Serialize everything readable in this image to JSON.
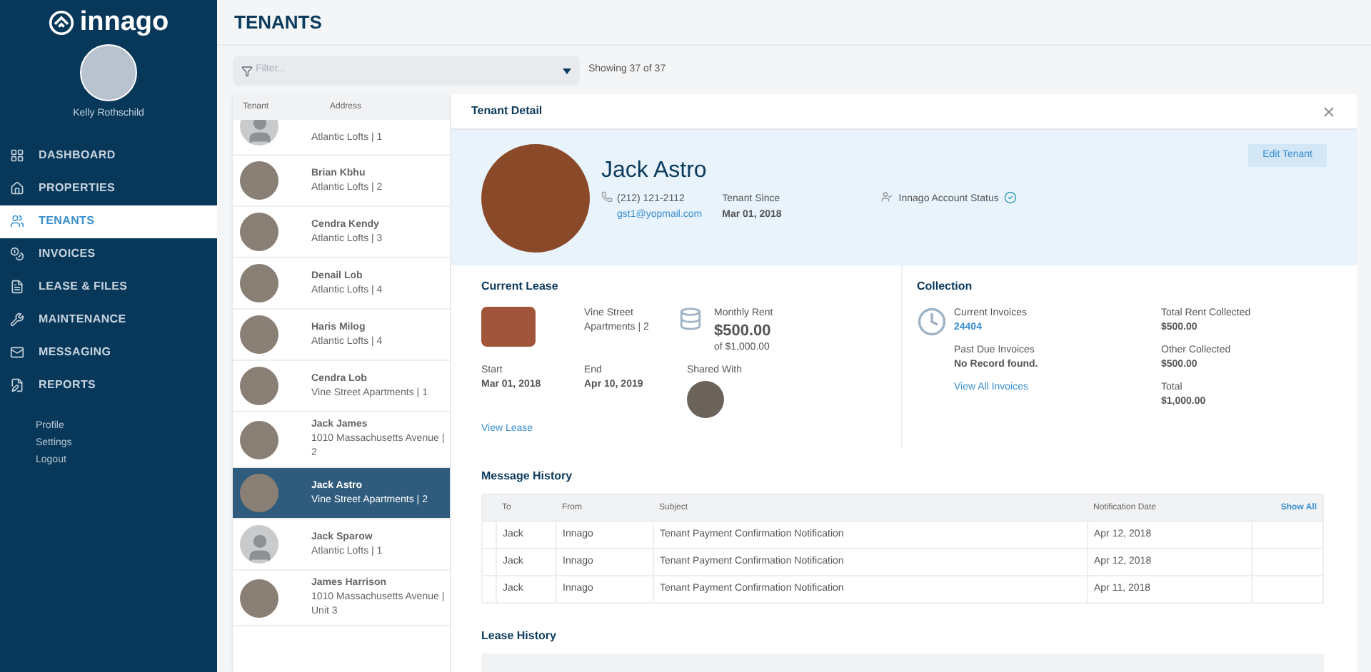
{
  "brand": "innago",
  "user": {
    "name": "Kelly Rothschild"
  },
  "nav": [
    {
      "label": "DASHBOARD",
      "selected": false
    },
    {
      "label": "PROPERTIES",
      "selected": false
    },
    {
      "label": "TENANTS",
      "selected": true
    },
    {
      "label": "INVOICES",
      "selected": false
    },
    {
      "label": "LEASE & FILES",
      "selected": false
    },
    {
      "label": "MAINTENANCE",
      "selected": false
    },
    {
      "label": "MESSAGING",
      "selected": false
    },
    {
      "label": "REPORTS",
      "selected": false
    }
  ],
  "account_links": [
    "Profile",
    "Settings",
    "Logout"
  ],
  "page_title": "TENANTS",
  "filter": {
    "placeholder": "Filter...",
    "count": "Showing 37 of 37"
  },
  "tenant_list": {
    "columns": [
      "Tenant",
      "Address"
    ],
    "rows": [
      {
        "name": "",
        "address": "Atlantic Lofts | 1",
        "photo": false,
        "selected": false
      },
      {
        "name": "Brian Kbhu",
        "address": "Atlantic Lofts | 2",
        "photo": true,
        "selected": false
      },
      {
        "name": "Cendra Kendy",
        "address": "Atlantic Lofts | 3",
        "photo": true,
        "selected": false
      },
      {
        "name": "Denail Lob",
        "address": "Atlantic Lofts | 4",
        "photo": true,
        "selected": false
      },
      {
        "name": "Haris Milog",
        "address": "Atlantic Lofts | 4",
        "photo": true,
        "selected": false
      },
      {
        "name": "Cendra Lob",
        "address": "Vine Street Apartments | 1",
        "photo": true,
        "selected": false
      },
      {
        "name": "Jack  James",
        "address": "1010 Massachusetts Avenue | 2",
        "photo": true,
        "selected": false
      },
      {
        "name": "Jack Astro",
        "address": "Vine Street Apartments | 2",
        "photo": true,
        "selected": true
      },
      {
        "name": "Jack Sparow",
        "address": "Atlantic Lofts | 1",
        "photo": false,
        "selected": false
      },
      {
        "name": "James Harrison",
        "address": "1010 Massachusetts Avenue | Unit 3",
        "photo": true,
        "selected": false
      }
    ]
  },
  "detail": {
    "title": "Tenant Detail",
    "edit_button": "Edit Tenant",
    "tenant": {
      "name": "Jack Astro",
      "phone": "(212) 121-2112",
      "email": "gst1@yopmail.com",
      "since_label": "Tenant Since",
      "since": "Mar 01, 2018",
      "account_status_label": "Innago Account Status",
      "account_verified": true
    },
    "lease": {
      "title": "Current Lease",
      "property": "Vine Street Apartments | 2",
      "rent_label": "Monthly Rent",
      "rent": "$500.00",
      "rent_total": "of $1,000.00",
      "start_label": "Start",
      "start": "Mar 01, 2018",
      "end_label": "End",
      "end": "Apr 10, 2019",
      "shared_label": "Shared With",
      "link": "View Lease"
    },
    "collection": {
      "title": "Collection",
      "current_label": "Current Invoices",
      "current": "24404",
      "past_label": "Past Due Invoices",
      "past": "No Record found.",
      "link": "View All Invoices",
      "totals": [
        {
          "label": "Total Rent Collected",
          "value": "$500.00"
        },
        {
          "label": "Other Collected",
          "value": "$500.00"
        },
        {
          "label": "Total",
          "value": "$1,000.00"
        }
      ]
    },
    "messages": {
      "title": "Message History",
      "columns": [
        "To",
        "From",
        "Subject",
        "Notification Date"
      ],
      "show_all": "Show All",
      "rows": [
        [
          "Jack",
          "Innago",
          "Tenant Payment Confirmation Notification",
          "Apr 12, 2018"
        ],
        [
          "Jack",
          "Innago",
          "Tenant Payment Confirmation Notification",
          "Apr 12, 2018"
        ],
        [
          "Jack",
          "Innago",
          "Tenant Payment Confirmation Notification",
          "Apr 11, 2018"
        ]
      ]
    },
    "lease_history": {
      "title": "Lease History"
    }
  }
}
